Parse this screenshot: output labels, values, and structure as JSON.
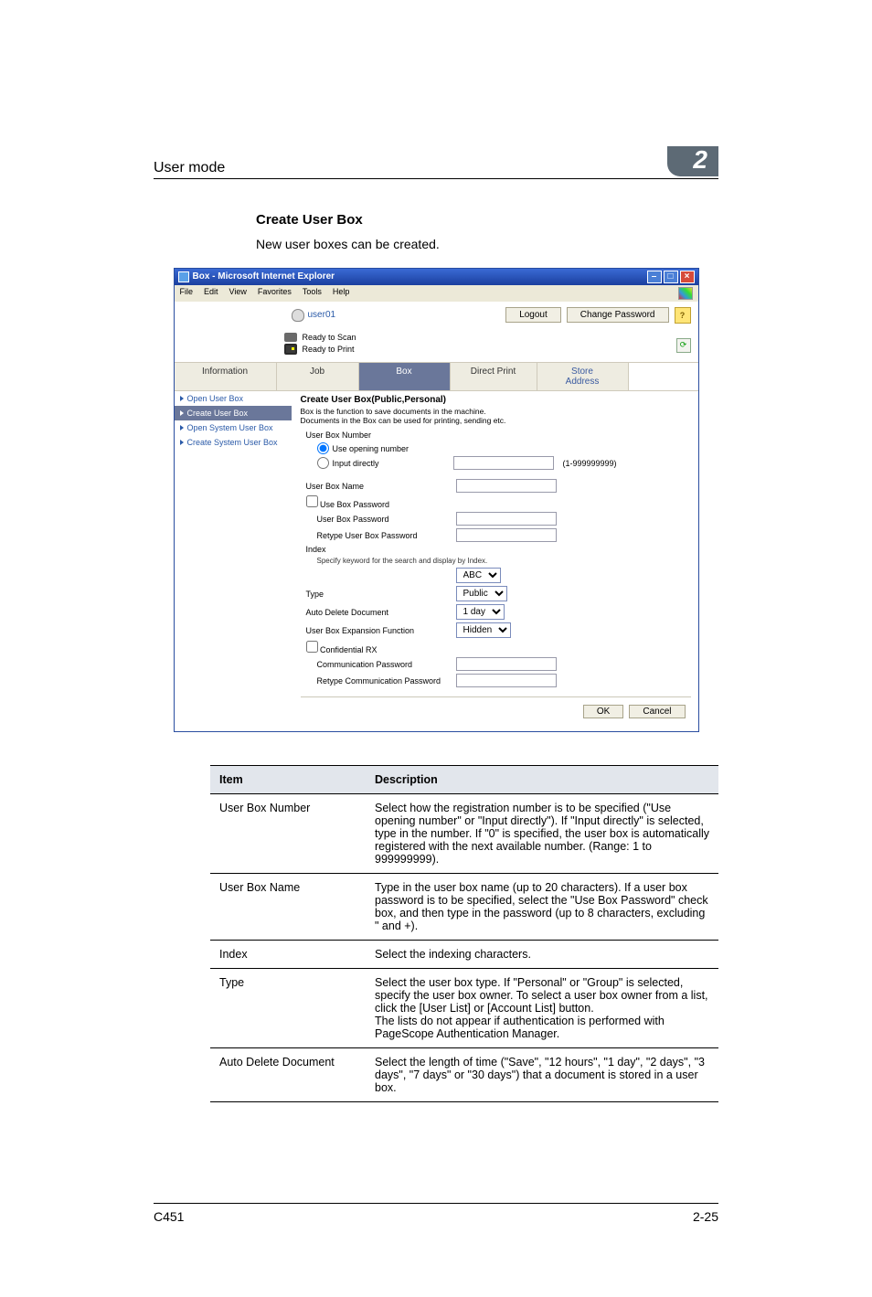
{
  "header": {
    "title": "User mode",
    "chapter": "2"
  },
  "section": {
    "title": "Create User Box",
    "body": "New user boxes can be created."
  },
  "ie": {
    "title": "Box - Microsoft Internet Explorer",
    "menu": {
      "file": "File",
      "edit": "Edit",
      "view": "View",
      "favorites": "Favorites",
      "tools": "Tools",
      "help": "Help"
    }
  },
  "app": {
    "user": "user01",
    "logout": "Logout",
    "change_password": "Change Password",
    "status": {
      "scan": "Ready to Scan",
      "print": "Ready to Print"
    },
    "tabs": {
      "info": "Information",
      "job": "Job",
      "box": "Box",
      "direct": "Direct Print",
      "addr": "Store Address"
    },
    "sidenav": {
      "open_user": "Open User Box",
      "create_user": "Create User Box",
      "open_system": "Open System User Box",
      "create_system": "Create System User Box"
    },
    "form": {
      "heading": "Create User Box(Public,Personal)",
      "desc1": "Box is the function to save documents in the machine.",
      "desc2": "Documents in the Box can be used for printing, sending etc.",
      "box_number": "User Box Number",
      "use_opening": "Use opening number",
      "input_directly": "Input directly",
      "range": "(1-999999999)",
      "box_name": "User Box Name",
      "use_box_password": "Use Box Password",
      "box_password": "User Box Password",
      "retype_box_password": "Retype User Box Password",
      "index": "Index",
      "index_note": "Specify keyword for the search and display by Index.",
      "index_value": "ABC",
      "type": "Type",
      "type_value": "Public",
      "auto_delete": "Auto Delete Document",
      "auto_delete_value": "1 day",
      "expansion": "User Box Expansion Function",
      "expansion_value": "Hidden",
      "confidential_rx": "Confidential RX",
      "comm_password": "Communication Password",
      "retype_comm_password": "Retype Communication Password",
      "ok": "OK",
      "cancel": "Cancel"
    }
  },
  "table": {
    "head_item": "Item",
    "head_desc": "Description",
    "rows": [
      {
        "item": "User Box Number",
        "desc": "Select how the registration number is to be specified (\"Use opening number\" or \"Input directly\"). If \"Input directly\" is selected, type in the number. If \"0\" is specified, the user box is automatically registered with the next available number. (Range: 1 to 999999999)."
      },
      {
        "item": "User Box Name",
        "desc": "Type in the user box name (up to 20 characters). If a user box password is to be specified, select the \"Use Box Password\" check box, and then type in the password (up to 8 characters, excluding \" and +)."
      },
      {
        "item": "Index",
        "desc": "Select the indexing characters."
      },
      {
        "item": "Type",
        "desc": "Select the user box type. If \"Personal\" or \"Group\" is selected, specify the user box owner. To select a user box owner from a list, click the [User List] or [Account List] button.\nThe lists do not appear if authentication is performed with PageScope Authentication Manager."
      },
      {
        "item": "Auto Delete Document",
        "desc": "Select the length of time (\"Save\", \"12 hours\", \"1 day\", \"2 days\", \"3 days\", \"7 days\" or \"30 days\") that a document is stored in a user box."
      }
    ]
  },
  "footer": {
    "left": "C451",
    "right": "2-25"
  }
}
